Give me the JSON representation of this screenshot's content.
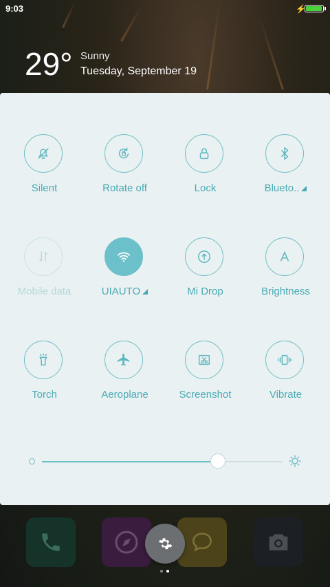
{
  "status_bar": {
    "time": "9:03",
    "battery_level": 1.0,
    "charging": true
  },
  "weather": {
    "temperature": "29°",
    "condition": "Sunny",
    "date": "Tuesday, September 19"
  },
  "tiles": [
    {
      "label": "Silent",
      "icon": "bell-off-icon",
      "state": "off"
    },
    {
      "label": "Rotate off",
      "icon": "rotate-lock-icon",
      "state": "off"
    },
    {
      "label": "Lock",
      "icon": "lock-icon",
      "state": "off"
    },
    {
      "label": "Blueto..",
      "icon": "bluetooth-icon",
      "state": "off",
      "has_menu": true
    },
    {
      "label": "Mobile data",
      "icon": "mobile-data-icon",
      "state": "disabled"
    },
    {
      "label": "UIAUTO",
      "icon": "wifi-icon",
      "state": "on",
      "has_menu": true
    },
    {
      "label": "Mi Drop",
      "icon": "mi-drop-icon",
      "state": "off"
    },
    {
      "label": "Brightness",
      "icon": "brightness-auto-icon",
      "state": "off"
    },
    {
      "label": "Torch",
      "icon": "torch-icon",
      "state": "off"
    },
    {
      "label": "Aeroplane",
      "icon": "airplane-icon",
      "state": "off"
    },
    {
      "label": "Screenshot",
      "icon": "screenshot-icon",
      "state": "off"
    },
    {
      "label": "Vibrate",
      "icon": "vibrate-icon",
      "state": "off"
    }
  ],
  "brightness": {
    "value": 0.73
  },
  "dock": [
    "phone-icon",
    "browser-icon",
    "settings-icon",
    "messages-icon",
    "camera-icon"
  ],
  "page_indicator": {
    "count": 2,
    "current": 1
  },
  "colors": {
    "accent": "#6cc0c9",
    "label": "#49aab4",
    "panel": "#eaf1f2"
  }
}
